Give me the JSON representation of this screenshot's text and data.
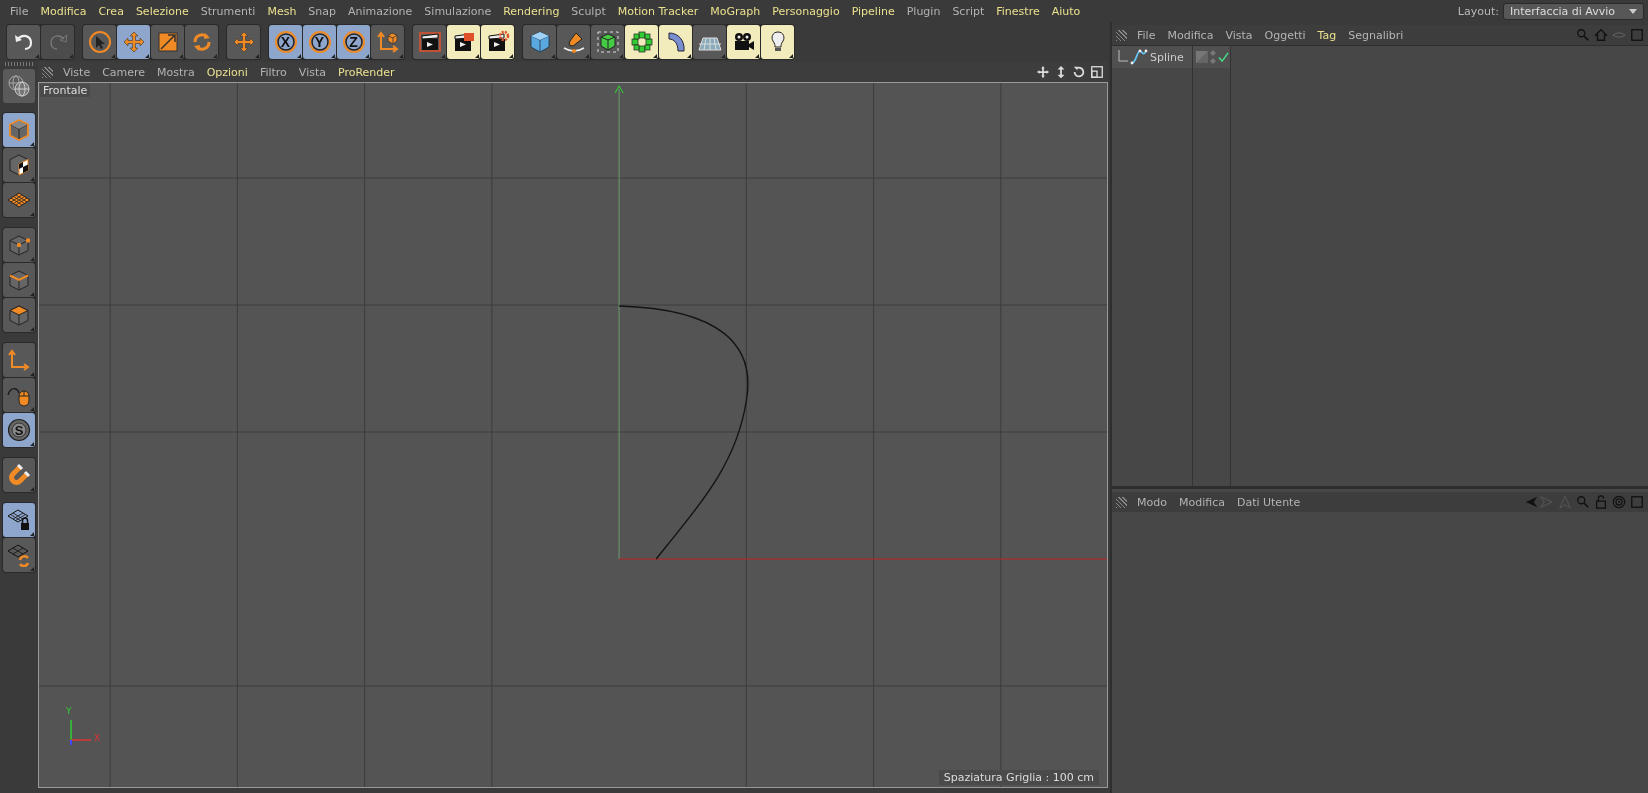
{
  "menu_bar": [
    {
      "label": "File",
      "highlighted": false
    },
    {
      "label": "Modifica",
      "highlighted": true
    },
    {
      "label": "Crea",
      "highlighted": true
    },
    {
      "label": "Selezione",
      "highlighted": true
    },
    {
      "label": "Strumenti",
      "highlighted": false
    },
    {
      "label": "Mesh",
      "highlighted": true
    },
    {
      "label": "Snap",
      "highlighted": false
    },
    {
      "label": "Animazione",
      "highlighted": false
    },
    {
      "label": "Simulazione",
      "highlighted": false
    },
    {
      "label": "Rendering",
      "highlighted": true
    },
    {
      "label": "Sculpt",
      "highlighted": false
    },
    {
      "label": "Motion Tracker",
      "highlighted": true
    },
    {
      "label": "MoGraph",
      "highlighted": true
    },
    {
      "label": "Personaggio",
      "highlighted": true
    },
    {
      "label": "Pipeline",
      "highlighted": true
    },
    {
      "label": "Plugin",
      "highlighted": false
    },
    {
      "label": "Script",
      "highlighted": false
    },
    {
      "label": "Finestre",
      "highlighted": true
    },
    {
      "label": "Aiuto",
      "highlighted": true
    }
  ],
  "layout": {
    "label": "Layout:",
    "value": "Interfaccia di Avvio"
  },
  "toolbar": {
    "groups": [
      [
        {
          "selected": false,
          "disabled": false
        },
        {
          "selected": false,
          "disabled": true
        }
      ],
      [
        {
          "selected": false,
          "disabled": false
        },
        {
          "selected": true,
          "disabled": false
        },
        {
          "selected": false,
          "disabled": false
        },
        {
          "selected": false,
          "disabled": false
        }
      ],
      [
        {
          "selected": false,
          "disabled": false
        }
      ],
      [
        {
          "label": "X",
          "selected": true,
          "disabled": false
        },
        {
          "label": "Y",
          "selected": true,
          "disabled": false
        },
        {
          "label": "Z",
          "selected": true,
          "disabled": false
        },
        {
          "selected": false,
          "disabled": false
        }
      ],
      [
        {
          "selected": false,
          "disabled": false
        },
        {
          "selected": false,
          "disabled": false
        },
        {
          "selected": false,
          "disabled": false
        }
      ],
      [
        {
          "selected": false,
          "disabled": false
        },
        {
          "selected": false,
          "disabled": false
        },
        {
          "selected": false,
          "disabled": false
        },
        {
          "selected": false,
          "disabled": false
        },
        {
          "selected": false,
          "disabled": false
        },
        {
          "selected": false,
          "disabled": false
        },
        {
          "selected": false,
          "disabled": false
        },
        {
          "selected": false,
          "disabled": false
        }
      ]
    ]
  },
  "left_toolbar": {
    "groups": [
      [
        {
          "selected": true
        },
        {
          "selected": false
        },
        {
          "selected": false
        }
      ],
      [
        {
          "selected": false
        },
        {
          "selected": false
        },
        {
          "selected": false
        }
      ],
      [
        {
          "selected": false
        },
        {
          "selected": false
        },
        {
          "label": "S",
          "selected": true
        }
      ],
      [
        {
          "selected": false
        }
      ],
      [
        {
          "selected": true
        },
        {
          "selected": false
        }
      ]
    ]
  },
  "viewport": {
    "menu": [
      {
        "label": "Viste",
        "highlighted": false
      },
      {
        "label": "Camere",
        "highlighted": false
      },
      {
        "label": "Mostra",
        "highlighted": false
      },
      {
        "label": "Opzioni",
        "highlighted": true
      },
      {
        "label": "Filtro",
        "highlighted": false
      },
      {
        "label": "Vista",
        "highlighted": false
      },
      {
        "label": "ProRender",
        "highlighted": true
      }
    ],
    "view_name": "Frontale",
    "axis_labels": {
      "y": "Y",
      "x": "X"
    },
    "grid_spacing": "Spaziatura Griglia : 100 cm"
  },
  "object_manager": {
    "menu": [
      {
        "label": "File",
        "highlighted": false
      },
      {
        "label": "Modifica",
        "highlighted": false
      },
      {
        "label": "Vista",
        "highlighted": false
      },
      {
        "label": "Oggetti",
        "highlighted": false
      },
      {
        "label": "Tag",
        "highlighted": true
      },
      {
        "label": "Segnalibri",
        "highlighted": false
      }
    ],
    "objects": [
      {
        "name": "Spline",
        "selected": false,
        "enabled": true
      }
    ]
  },
  "attribute_manager": {
    "menu": [
      {
        "label": "Modo",
        "highlighted": false
      },
      {
        "label": "Modifica",
        "highlighted": false
      },
      {
        "label": "Dati Utente",
        "highlighted": false
      }
    ]
  }
}
